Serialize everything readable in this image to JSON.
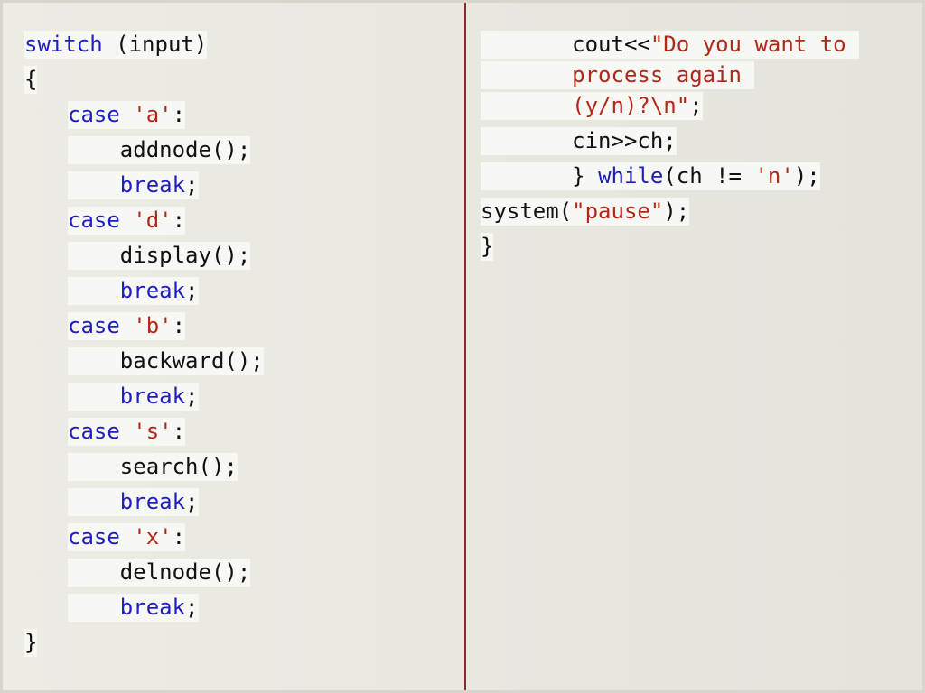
{
  "left": {
    "lines": [
      {
        "prefix": "",
        "keyword": "switch",
        "middle": " (input)",
        "string": "",
        "suffix": ""
      },
      {
        "prefix": "",
        "keyword": "",
        "middle": "{",
        "string": "",
        "suffix": ""
      },
      {
        "prefix": "",
        "keyword": "case",
        "middle": " ",
        "string": "'a'",
        "suffix": ":"
      },
      {
        "prefix": "    ",
        "keyword": "",
        "middle": "addnode();",
        "string": "",
        "suffix": ""
      },
      {
        "prefix": "    ",
        "keyword": "break",
        "middle": ";",
        "string": "",
        "suffix": ""
      },
      {
        "prefix": "",
        "keyword": "case",
        "middle": " ",
        "string": "'d'",
        "suffix": ":"
      },
      {
        "prefix": "    ",
        "keyword": "",
        "middle": "display();",
        "string": "",
        "suffix": ""
      },
      {
        "prefix": "    ",
        "keyword": "break",
        "middle": ";",
        "string": "",
        "suffix": ""
      },
      {
        "prefix": "",
        "keyword": "case",
        "middle": " ",
        "string": "'b'",
        "suffix": ":"
      },
      {
        "prefix": "    ",
        "keyword": "",
        "middle": "backward();",
        "string": "",
        "suffix": ""
      },
      {
        "prefix": "    ",
        "keyword": "break",
        "middle": ";",
        "string": "",
        "suffix": ""
      },
      {
        "prefix": "",
        "keyword": "case",
        "middle": " ",
        "string": "'s'",
        "suffix": ":"
      },
      {
        "prefix": "    ",
        "keyword": "",
        "middle": "search();",
        "string": "",
        "suffix": ""
      },
      {
        "prefix": "    ",
        "keyword": "break",
        "middle": ";",
        "string": "",
        "suffix": ""
      },
      {
        "prefix": "",
        "keyword": "case",
        "middle": " ",
        "string": "'x'",
        "suffix": ":"
      },
      {
        "prefix": "    ",
        "keyword": "",
        "middle": "delnode();",
        "string": "",
        "suffix": ""
      },
      {
        "prefix": "    ",
        "keyword": "break",
        "middle": ";",
        "string": "",
        "suffix": ""
      },
      {
        "prefix": "",
        "keyword": "",
        "middle": "}",
        "string": "",
        "suffix": ""
      }
    ]
  },
  "right": {
    "lines": [
      {
        "prefix": "       ",
        "keyword": "",
        "middle": "cout<<",
        "string": "\"Do you want to ",
        "suffix": ""
      },
      {
        "prefix": "       ",
        "keyword": "",
        "middle": "",
        "string": "process again ",
        "suffix": ""
      },
      {
        "prefix": "       ",
        "keyword": "",
        "middle": "",
        "string": "(y/n)?\\n\"",
        "suffix": ";"
      },
      {
        "prefix": "       ",
        "keyword": "",
        "middle": "cin>>ch;",
        "string": "",
        "suffix": ""
      },
      {
        "prefix": "       ",
        "keyword": "while",
        "middle": "(ch != ",
        "string": "'n'",
        "suffix": ");"
      },
      {
        "prefix": "",
        "keyword": "",
        "middle": "system(",
        "string": "\"pause\"",
        "suffix": ");"
      },
      {
        "prefix": "",
        "keyword": "",
        "middle": "}",
        "string": "",
        "suffix": ""
      }
    ]
  }
}
